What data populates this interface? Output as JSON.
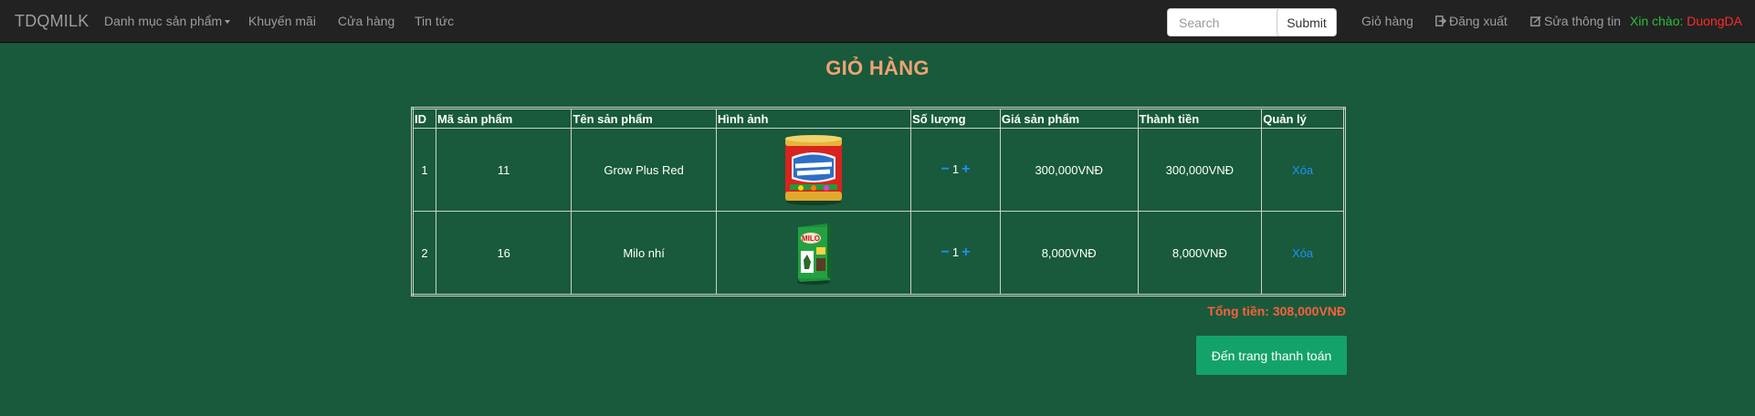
{
  "navbar": {
    "brand": "TDQMILK",
    "menu": {
      "category": "Danh mục sản phẩm",
      "promo": "Khuyến mãi",
      "store": "Cửa hàng",
      "news": "Tin tức"
    },
    "search": {
      "placeholder": "Search",
      "submit": "Submit"
    },
    "cart": "Giỏ hàng",
    "logout": "Đăng xuất",
    "edit_profile": "Sửa thông tin",
    "greeting_label": "Xin chào:",
    "username": "DuongDA",
    "colors": {
      "greeting": "#2bbf3a",
      "username": "#ff2a2a"
    }
  },
  "page_title": "GIỎ HÀNG",
  "table": {
    "headers": [
      "ID",
      "Mã sản phẩm",
      "Tên sản phẩm",
      "Hình ảnh",
      "Số lượng",
      "Giá sản phẩm",
      "Thành tiền",
      "Quản lý"
    ],
    "rows": [
      {
        "id": "1",
        "code": "11",
        "name": "Grow Plus Red",
        "image": "grow-plus-red-can-image",
        "qty": "1",
        "price": "300,000VNĐ",
        "subtotal": "300,000VNĐ",
        "action": "Xóa"
      },
      {
        "id": "2",
        "code": "16",
        "name": "Milo nhí",
        "image": "milo-box-image",
        "qty": "1",
        "price": "8,000VNĐ",
        "subtotal": "8,000VNĐ",
        "action": "Xóa"
      }
    ],
    "qty_controls": {
      "minus": "−",
      "plus": "+"
    }
  },
  "total": "Tổng tiền: 308,000VNĐ",
  "checkout_button": "Đến trang thanh toán",
  "colors": {
    "background": "#185a3b",
    "title": "#f0a274",
    "total": "#ff5f3d",
    "checkout": "#13a36a",
    "link": "#1e90ff"
  }
}
